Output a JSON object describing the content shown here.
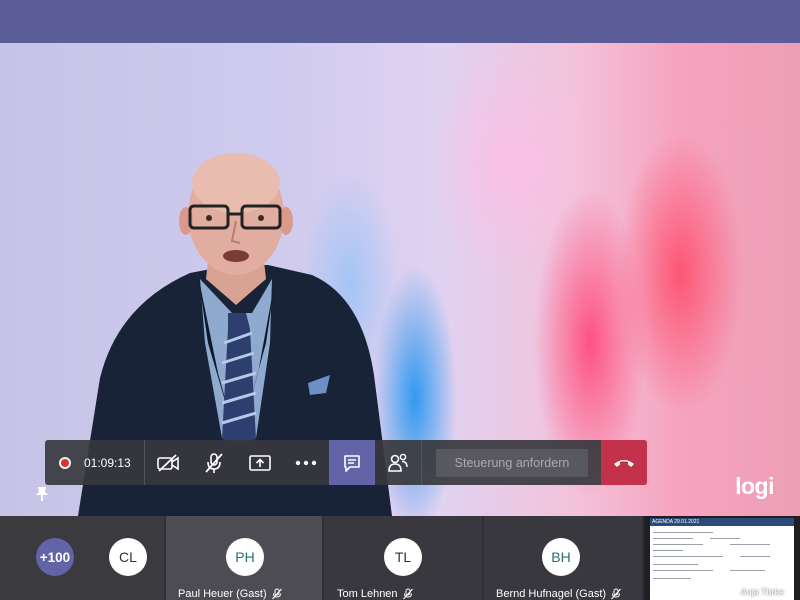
{
  "toolbar": {
    "timer": "01:09:13",
    "request_control_label": "Steuerung anfordern"
  },
  "video": {
    "logo": "logi"
  },
  "participants": {
    "overflow_badge": "+100",
    "tiles": [
      {
        "initials": "CL",
        "name": ""
      },
      {
        "initials": "PH",
        "name": "Paul Heuer (Gast)"
      },
      {
        "initials": "TL",
        "name": "Tom Lehnen"
      },
      {
        "initials": "BH",
        "name": "Bernd Hufnagel (Gast)"
      }
    ]
  },
  "shared_content": {
    "title": "AGENDA 29.01.2021",
    "presenter": "Anja Türke"
  },
  "colors": {
    "brand": "#6264a7",
    "hangup": "#c4314b",
    "record": "#d13438"
  }
}
